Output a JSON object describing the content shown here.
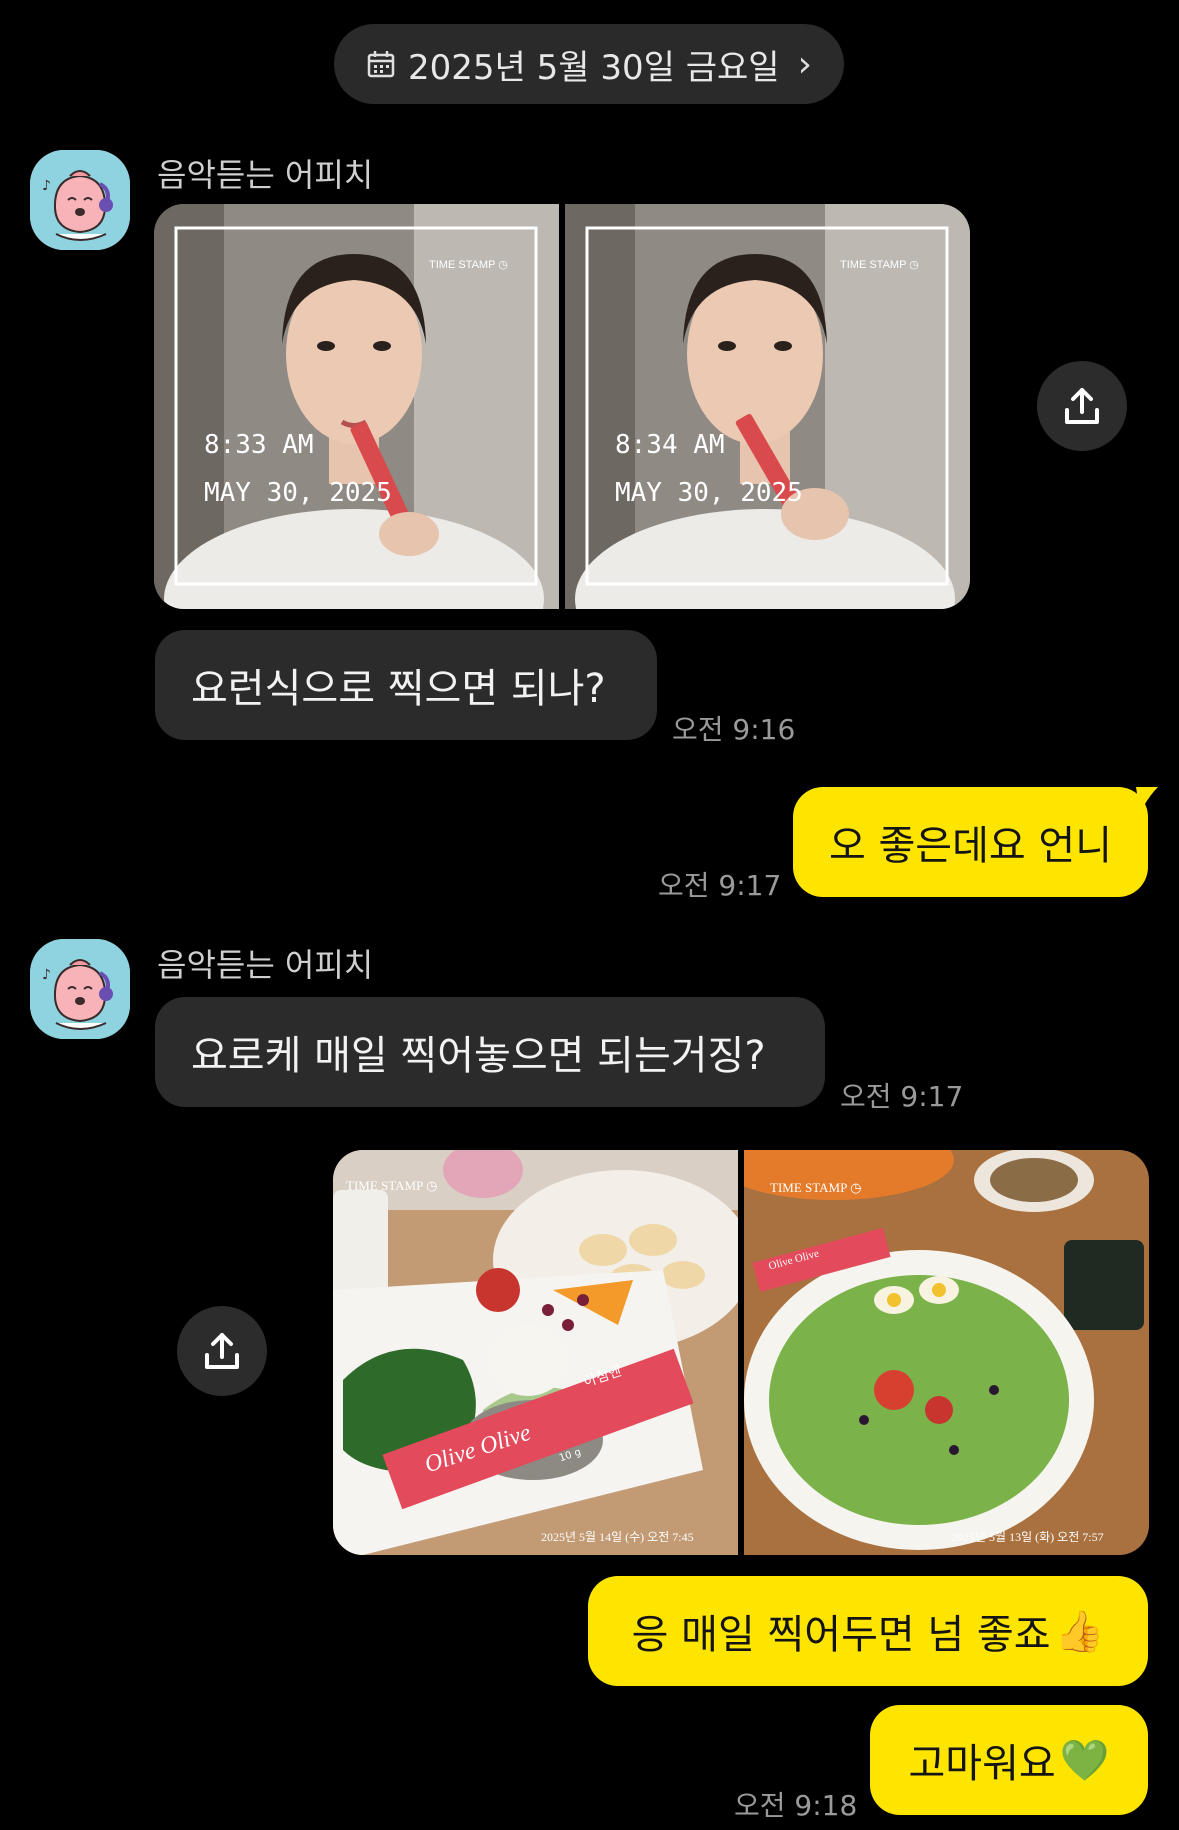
{
  "date_bar": {
    "label": "2025년 5월 30일 금요일",
    "icon": "calendar-icon",
    "chevron": "›"
  },
  "messages": [
    {
      "sender": "음악듣는 어피치",
      "photos": [
        {
          "time": "8:33 AM",
          "date": "MAY 30, 2025",
          "stamp": "TIME STAMP"
        },
        {
          "time": "8:34 AM",
          "date": "MAY 30, 2025",
          "stamp": "TIME STAMP"
        }
      ],
      "text": "요런식으로 찍으면 되나?",
      "time": "오전 9:16"
    },
    {
      "text": "오 좋은데요 언니",
      "time": "오전 9:17"
    },
    {
      "sender": "음악듣는 어피치",
      "text": "요로케 매일 찍어놓으면 되는거징?",
      "time": "오전 9:17"
    },
    {
      "photos": [
        {
          "stamp": "TIME STAMP",
          "caption": "2025년 5월 14일 (수) 오전 7:45",
          "package": "Olive Olive",
          "package_small": "아침엔",
          "package_weight": "10 g"
        },
        {
          "stamp": "TIME STAMP",
          "caption": "2025년 5월 13일 (화) 오전 7:57",
          "package": "Olive Olive"
        }
      ]
    },
    {
      "text": "응 매일 찍어두면 넘 좋죠",
      "emoji": "👍"
    },
    {
      "text": "고마워요",
      "emoji": "💚",
      "time": "오전 9:18"
    }
  ],
  "colors": {
    "background": "#000000",
    "incoming_bubble": "#2b2b2b",
    "outgoing_bubble": "#fee500"
  }
}
